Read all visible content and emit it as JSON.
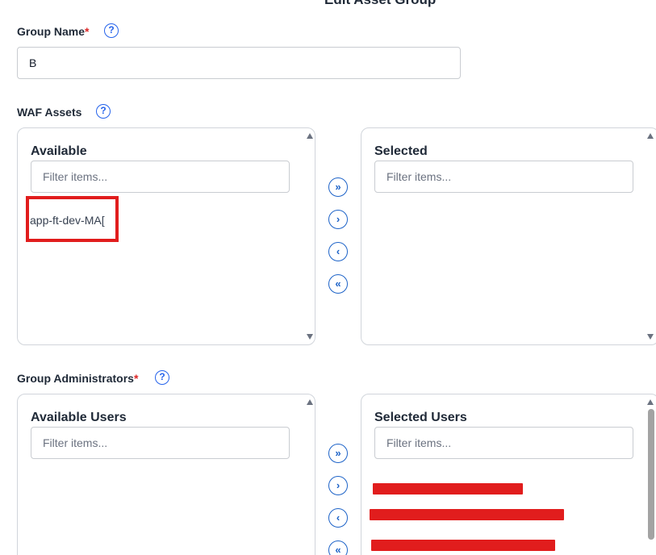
{
  "dialog": {
    "title": "Edit Asset Group"
  },
  "group_name": {
    "label": "Group Name",
    "required_mark": "*",
    "help_icon": "?",
    "value": "B"
  },
  "waf_assets": {
    "label": "WAF Assets",
    "help_icon": "?",
    "available": {
      "title": "Available",
      "filter_placeholder": "Filter items...",
      "items": [
        "app-ft-dev-MA["
      ]
    },
    "selected": {
      "title": "Selected",
      "filter_placeholder": "Filter items...",
      "items": []
    },
    "buttons": {
      "move_all_right": "»",
      "move_right": "›",
      "move_left": "‹",
      "move_all_left": "«"
    }
  },
  "group_admins": {
    "label": "Group Administrators",
    "required_mark": "*",
    "help_icon": "?",
    "available": {
      "title": "Available Users",
      "filter_placeholder": "Filter items...",
      "items": []
    },
    "selected": {
      "title": "Selected Users",
      "filter_placeholder": "Filter items...",
      "items": [
        "redacted-user-1",
        "redacted-user-2",
        "redacted-user-3"
      ]
    },
    "buttons": {
      "move_all_right": "»",
      "move_right": "›",
      "move_left": "‹",
      "move_all_left": "«"
    }
  },
  "colors": {
    "accent": "#1d63c8",
    "required": "#dc2626",
    "annotation_red": "#e11d1d",
    "border": "#d1d5db"
  },
  "icons": {
    "help": "question-circle-icon",
    "move_all_right": "double-chevron-right-icon",
    "move_right": "chevron-right-icon",
    "move_left": "chevron-left-icon",
    "move_all_left": "double-chevron-left-icon",
    "scroll_up": "scroll-up-arrow-icon",
    "scroll_down": "scroll-down-arrow-icon"
  }
}
